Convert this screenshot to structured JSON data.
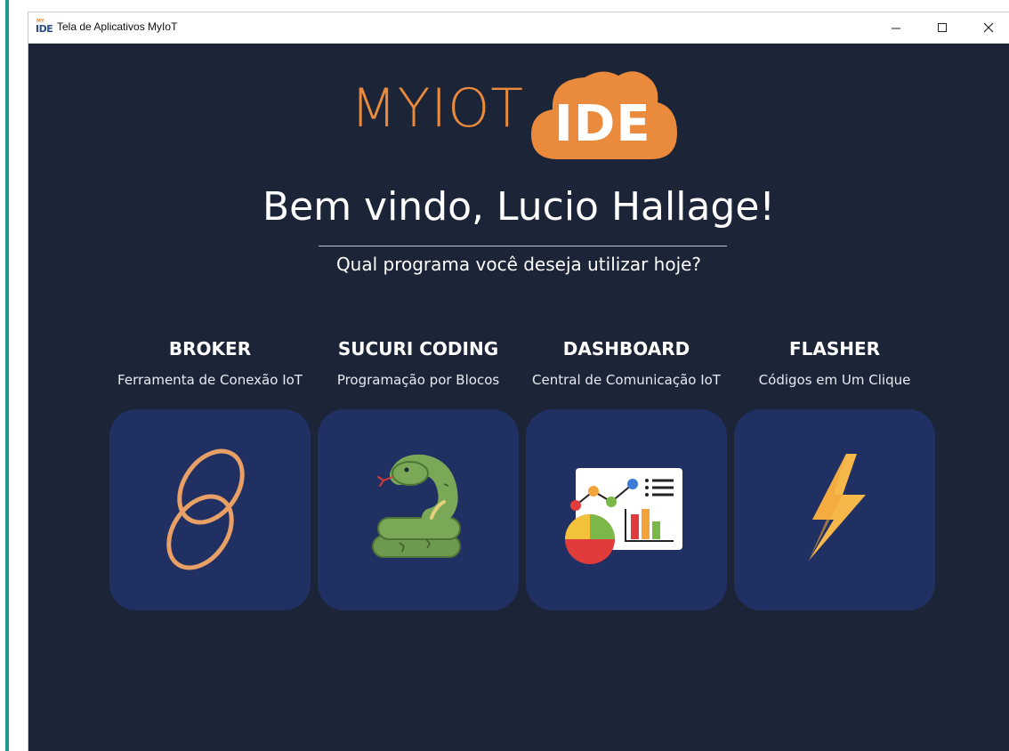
{
  "window": {
    "title": "Tela de Aplicativos MyIoT"
  },
  "logo": {
    "part1": "MYIOT",
    "part2": "IDE",
    "icon_small": "MY",
    "icon_big": "IDE"
  },
  "welcome": {
    "heading": "Bem vindo, Lucio Hallage!",
    "subheading": "Qual programa você deseja utilizar hoje?"
  },
  "apps": [
    {
      "title": "BROKER",
      "description": "Ferramenta de Conexão IoT",
      "icon": "chain-link-icon"
    },
    {
      "title": "SUCURI CODING",
      "description": "Programação por Blocos",
      "icon": "snake-icon"
    },
    {
      "title": "DASHBOARD",
      "description": "Central de Comunicação IoT",
      "icon": "dashboard-chart-icon"
    },
    {
      "title": "FLASHER",
      "description": "Códigos em Um Clique",
      "icon": "lightning-bolt-icon"
    }
  ],
  "colors": {
    "background": "#1c2438",
    "tile": "#213062",
    "accent": "#e98a3c",
    "left_accent": "#1a9a8e"
  }
}
